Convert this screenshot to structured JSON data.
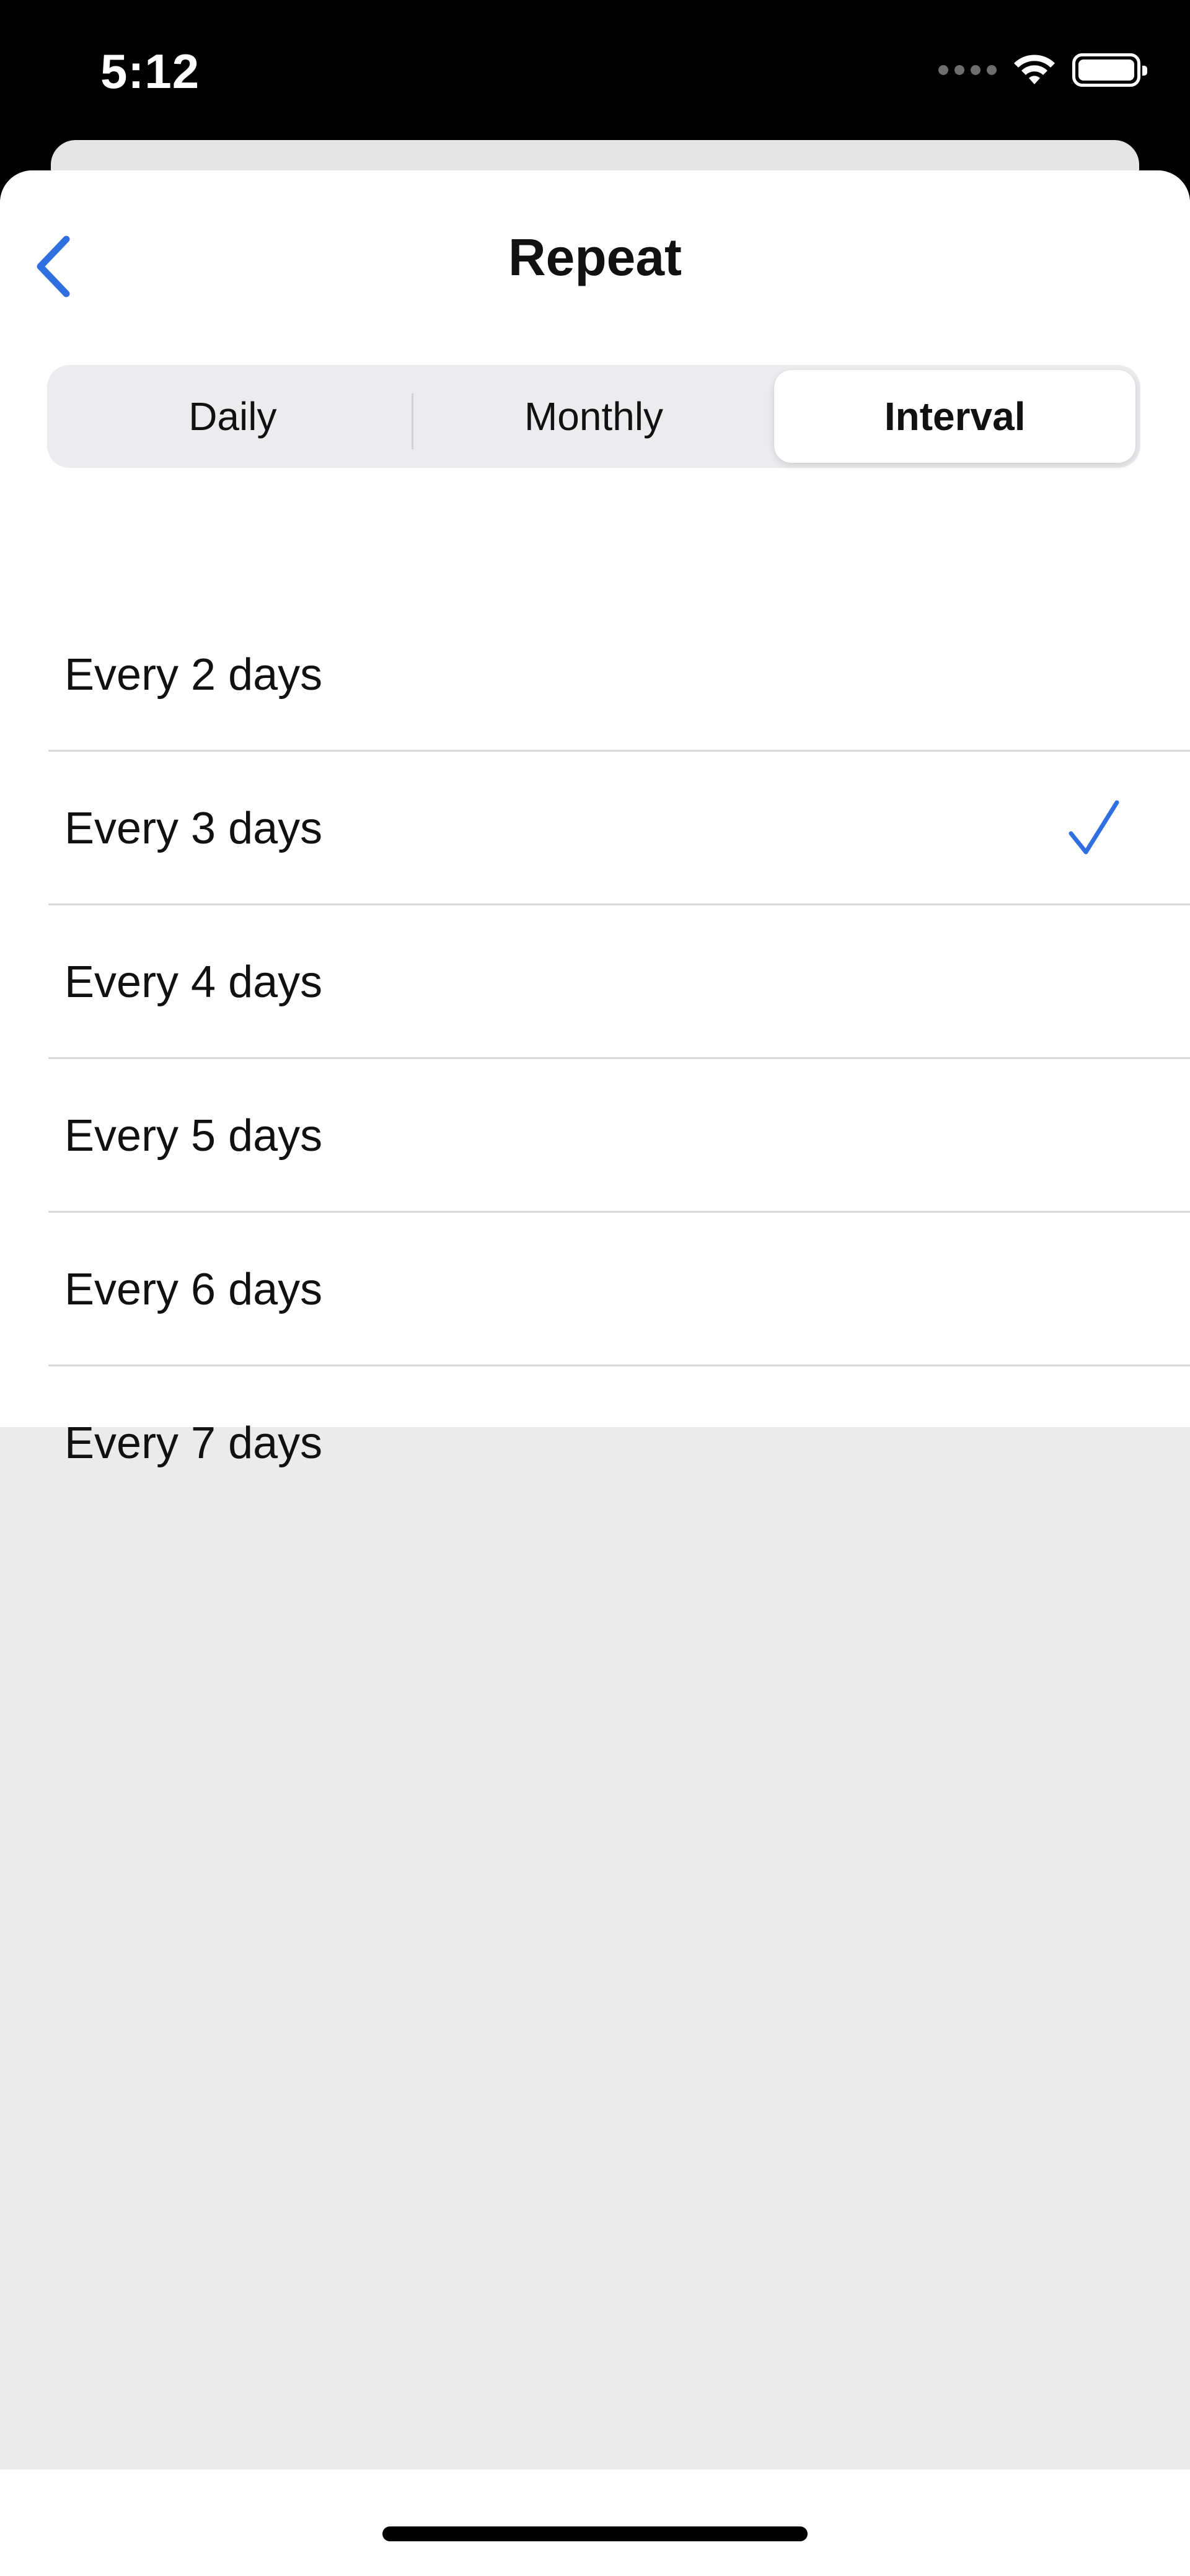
{
  "status_bar": {
    "time": "5:12"
  },
  "nav": {
    "title": "Repeat",
    "back_icon": "chevron-left-icon"
  },
  "segments": [
    {
      "label": "Daily",
      "selected": false
    },
    {
      "label": "Monthly",
      "selected": false
    },
    {
      "label": "Interval",
      "selected": true
    }
  ],
  "interval_options": [
    {
      "label": "Every 2 days",
      "checked": false
    },
    {
      "label": "Every 3 days",
      "checked": true
    },
    {
      "label": "Every 4 days",
      "checked": false
    },
    {
      "label": "Every 5 days",
      "checked": false
    },
    {
      "label": "Every 6 days",
      "checked": false
    },
    {
      "label": "Every 7 days",
      "checked": false
    }
  ],
  "colors": {
    "accent": "#2f6fe0",
    "sheet_background": "#ebebeb",
    "segmented_background": "#ececef"
  }
}
